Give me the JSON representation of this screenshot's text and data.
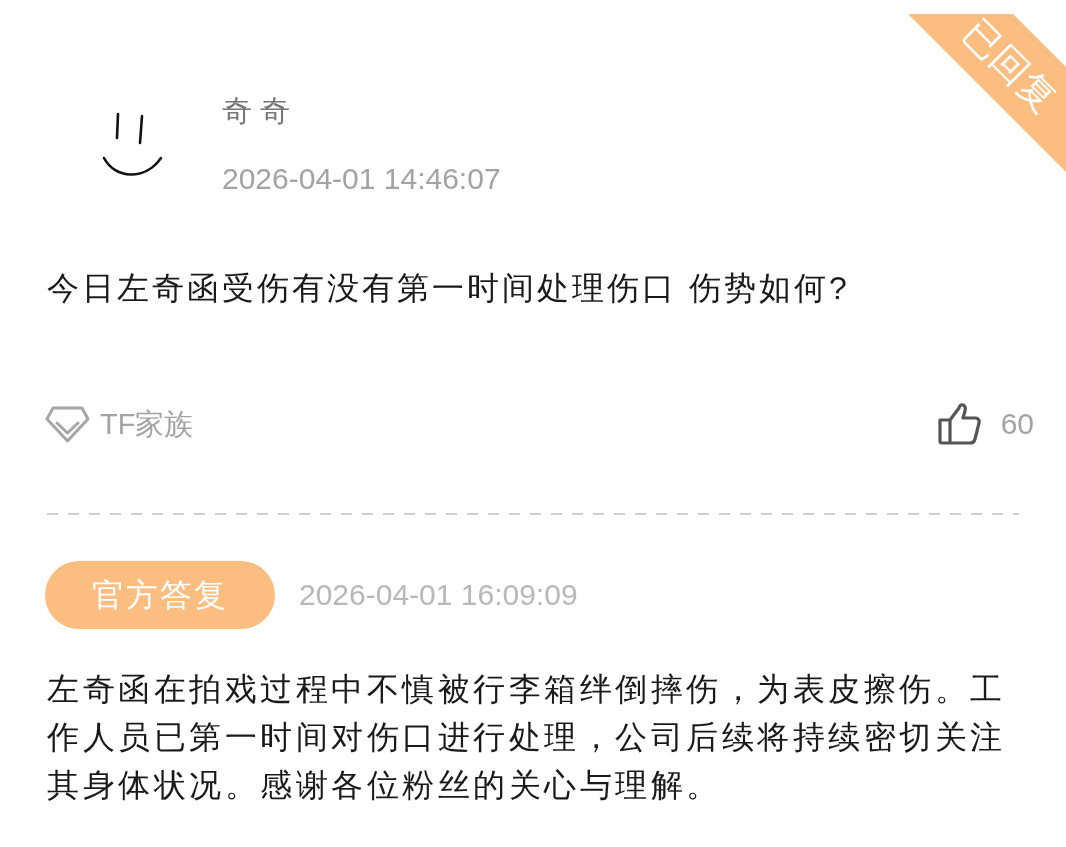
{
  "ribbon": {
    "label": "已回复"
  },
  "question": {
    "author": "奇 奇",
    "time": "2026-04-01 14:46:07",
    "text": "今日左奇函受伤有没有第一时间处理伤口 伤势如何?",
    "group": "TF家族",
    "likes": "60"
  },
  "reply": {
    "badge": "官方答复",
    "time": "2026-04-01 16:09:09",
    "text": "左奇函在拍戏过程中不慎被行李箱绊倒摔伤，为表皮擦伤。工作人员已第一时间对伤口进行处理，公司后续将持续密切关注其身体状况。感谢各位粉丝的关心与理解。"
  }
}
